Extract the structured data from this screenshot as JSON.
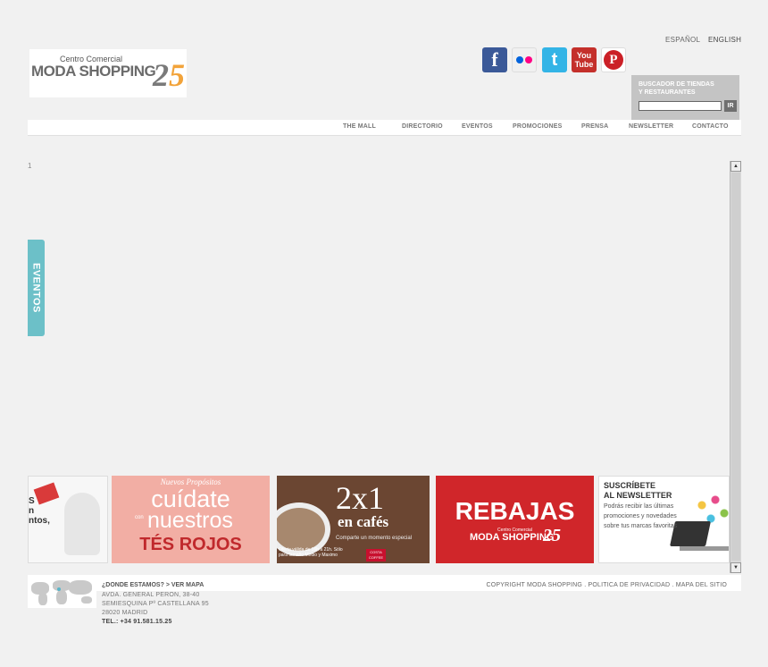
{
  "languages": {
    "es": "ESPAÑOL",
    "en": "ENGLISH"
  },
  "logo": {
    "small": "Centro Comercial",
    "brand": "MODA SHOPPING",
    "number_a": "2",
    "number_b": "5"
  },
  "social": [
    {
      "name": "facebook",
      "glyph": "f"
    },
    {
      "name": "flickr",
      "glyph": ""
    },
    {
      "name": "twitter",
      "glyph": "t"
    },
    {
      "name": "youtube",
      "glyph_a": "You",
      "glyph_b": "Tube"
    },
    {
      "name": "pinterest",
      "glyph": "P"
    }
  ],
  "search": {
    "title_1": "BUSCADOR DE TIENDAS",
    "title_2": "Y RESTAURANTES",
    "value": "",
    "button": "IR"
  },
  "nav": [
    "THE MALL",
    "DIRECTORIO",
    "EVENTOS",
    "PROMOCIONES",
    "PRENSA",
    "NEWSLETTER",
    "CONTACTO"
  ],
  "page_number": "1",
  "eventos_tab": "EVENTOS",
  "banners": {
    "b1": {
      "line1": "S",
      "line2": "n",
      "line3": "ntos,"
    },
    "b2": {
      "l1": "Nuevos Propósitos",
      "l2": "cuídate",
      "l3": "con",
      "l4": "nuestros",
      "l5": "TÉS ROJOS"
    },
    "b3": {
      "l1": "2x1",
      "l2": "en cafés",
      "l3": "Comparte un momento especial",
      "l4": "Oferta válida de 16h a 21h. Sólo para tamaño Medio y Maximo",
      "badge": "COSTA COFFEE"
    },
    "b4": {
      "l1": "REBAJAS",
      "l2": "Centro Comercial",
      "l3": "MODA SHOPPING",
      "l4": "25"
    },
    "b5": {
      "l1a": "SUSCRÍBETE",
      "l1b": "AL NEWSLETTER",
      "l2": "Podrás recibir las últimas promociones y novedades sobre tus marcas favoritas"
    }
  },
  "footer": {
    "where": "¿DONDE ESTAMOS? > VER MAPA",
    "copyright": "COPYRIGHT MODA SHOPPING . POLITICA DE PRIVACIDAD . MAPA DEL SITIO",
    "address": [
      "AVDA. GENERAL PERON, 38-40",
      "SEMIESQUINA Pº CASTELLANA 95",
      "28020 MADRID"
    ],
    "tel": "TEL.: +34 91.581.15.25"
  },
  "colors": {
    "accent": "#6cc0c8",
    "facebook": "#3b5998",
    "twitter": "#33b4e6",
    "youtube": "#c4302b",
    "pinterest": "#cb2027",
    "rebajas": "#d0262a"
  }
}
